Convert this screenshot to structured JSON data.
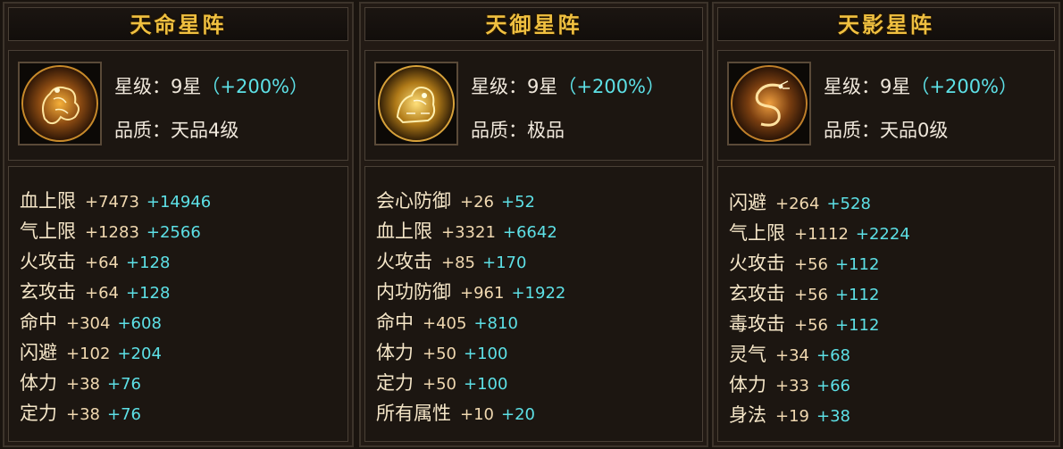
{
  "colors": {
    "title": "#f0c040",
    "bonus": "#5de0e6",
    "text": "#f0e8dc",
    "panel_bg": "#221a14"
  },
  "panels": [
    {
      "title": "天命星阵",
      "icon": "golden-qilin-medallion-icon",
      "level_label": "星级：",
      "level_value": "9星",
      "level_bonus": "（+200%）",
      "quality_label": "品质：",
      "quality_value": "天品4级",
      "stats": [
        {
          "name": "血上限",
          "base": "+7473",
          "bonus": "+14946"
        },
        {
          "name": "气上限",
          "base": "+1283",
          "bonus": "+2566"
        },
        {
          "name": "火攻击",
          "base": "+64",
          "bonus": "+128"
        },
        {
          "name": "玄攻击",
          "base": "+64",
          "bonus": "+128"
        },
        {
          "name": "命中",
          "base": "+304",
          "bonus": "+608"
        },
        {
          "name": "闪避",
          "base": "+102",
          "bonus": "+204"
        },
        {
          "name": "体力",
          "base": "+38",
          "bonus": "+76"
        },
        {
          "name": "定力",
          "base": "+38",
          "bonus": "+76"
        }
      ]
    },
    {
      "title": "天御星阵",
      "icon": "golden-lion-medallion-icon",
      "level_label": "星级：",
      "level_value": "9星",
      "level_bonus": "（+200%）",
      "quality_label": "品质：",
      "quality_value": "极品",
      "stats": [
        {
          "name": "会心防御",
          "base": "+26",
          "bonus": "+52"
        },
        {
          "name": "血上限",
          "base": "+3321",
          "bonus": "+6642"
        },
        {
          "name": "火攻击",
          "base": "+85",
          "bonus": "+170"
        },
        {
          "name": "内功防御",
          "base": "+961",
          "bonus": "+1922"
        },
        {
          "name": "命中",
          "base": "+405",
          "bonus": "+810"
        },
        {
          "name": "体力",
          "base": "+50",
          "bonus": "+100"
        },
        {
          "name": "定力",
          "base": "+50",
          "bonus": "+100"
        },
        {
          "name": "所有属性",
          "base": "+10",
          "bonus": "+20"
        }
      ]
    },
    {
      "title": "天影星阵",
      "icon": "golden-dragon-medallion-icon",
      "level_label": "星级：",
      "level_value": "9星",
      "level_bonus": "（+200%）",
      "quality_label": "品质：",
      "quality_value": "天品0级",
      "stats": [
        {
          "name": "闪避",
          "base": "+264",
          "bonus": "+528"
        },
        {
          "name": "气上限",
          "base": "+1112",
          "bonus": "+2224"
        },
        {
          "name": "火攻击",
          "base": "+56",
          "bonus": "+112"
        },
        {
          "name": "玄攻击",
          "base": "+56",
          "bonus": "+112"
        },
        {
          "name": "毒攻击",
          "base": "+56",
          "bonus": "+112"
        },
        {
          "name": "灵气",
          "base": "+34",
          "bonus": "+68"
        },
        {
          "name": "体力",
          "base": "+33",
          "bonus": "+66"
        },
        {
          "name": "身法",
          "base": "+19",
          "bonus": "+38"
        }
      ]
    }
  ]
}
